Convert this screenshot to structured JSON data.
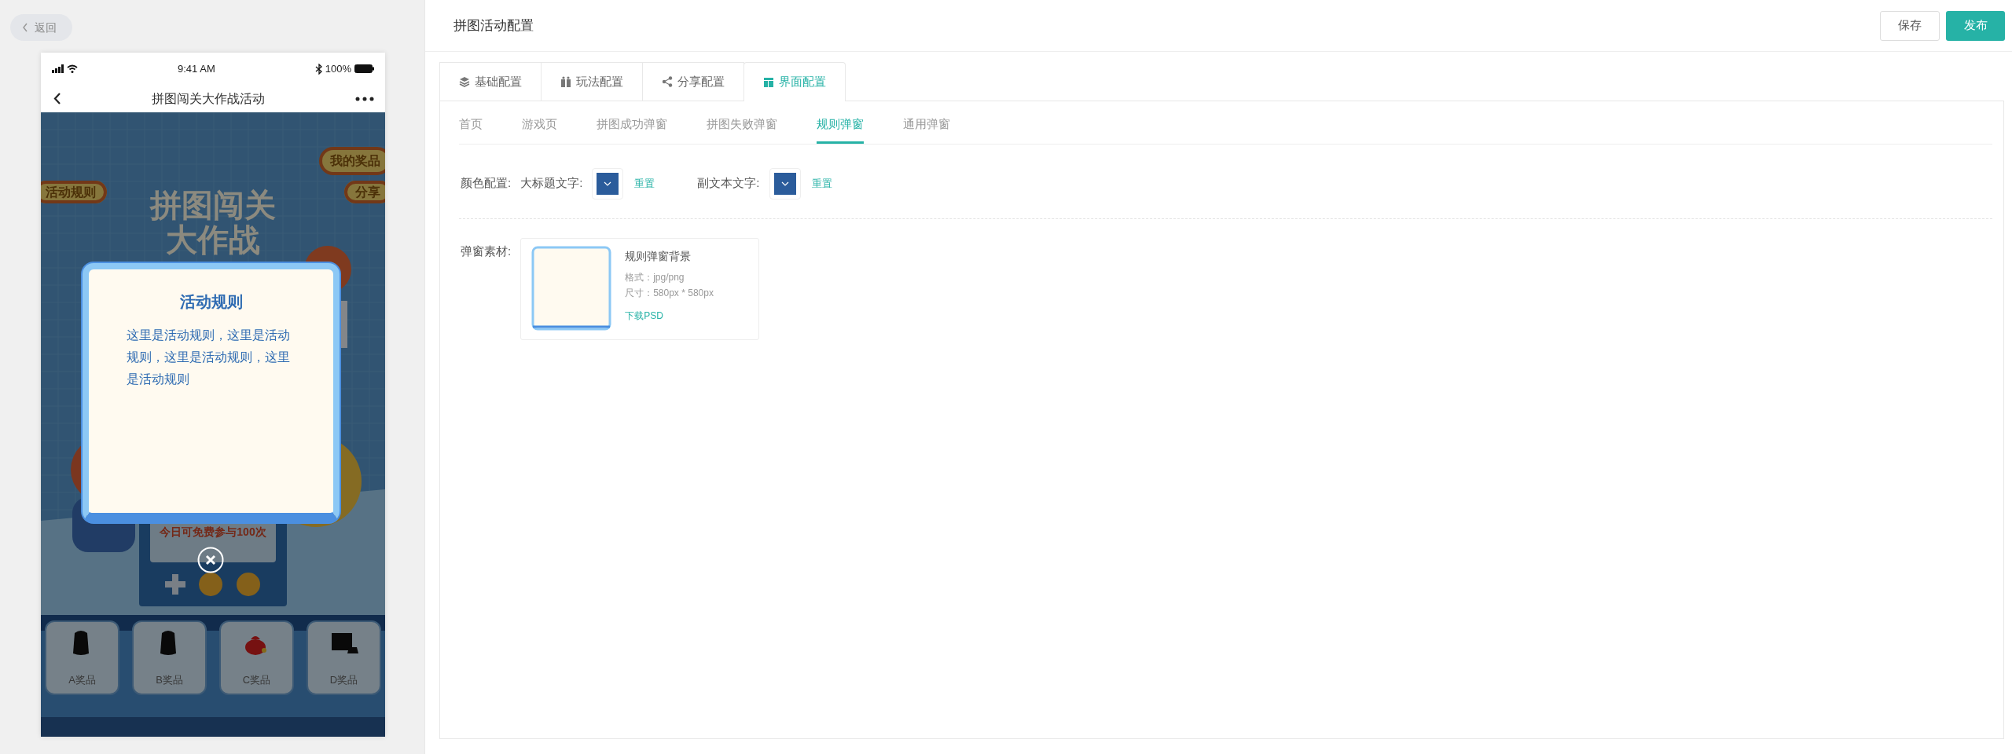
{
  "back_button": {
    "label": "返回"
  },
  "phone": {
    "status_bar": {
      "time": "9:41 AM",
      "battery": "100%"
    },
    "nav_title": "拼图闯关大作战活动",
    "game": {
      "top_buttons": [
        {
          "label": "我的奖品"
        },
        {
          "label": "活动规则"
        },
        {
          "label": "分享"
        }
      ],
      "banner_title": [
        "拼图闯关",
        "大作战"
      ],
      "free_plays": "今日可免费参与100次",
      "prizes": [
        {
          "label": "A奖品",
          "kind": "backpack"
        },
        {
          "label": "B奖品",
          "kind": "backpack"
        },
        {
          "label": "C奖品",
          "kind": "pouch"
        },
        {
          "label": "D奖品",
          "kind": "console"
        }
      ]
    },
    "rule_popup": {
      "title": "活动规则",
      "body": "这里是活动规则，这里是活动规则，这里是活动规则，这里是活动规则"
    }
  },
  "header": {
    "title": "拼图活动配置",
    "buttons": [
      {
        "label": "保存",
        "kind": "default"
      },
      {
        "label": "发布",
        "kind": "primary"
      }
    ]
  },
  "tabs": [
    {
      "label": "基础配置",
      "kind": "layers",
      "selected": false
    },
    {
      "label": "玩法配置",
      "kind": "gift",
      "selected": false
    },
    {
      "label": "分享配置",
      "kind": "share",
      "selected": false
    },
    {
      "label": "界面配置",
      "kind": "layout",
      "selected": true
    }
  ],
  "subtabs": [
    {
      "label": "首页",
      "selected": false
    },
    {
      "label": "游戏页",
      "selected": false
    },
    {
      "label": "拼图成功弹窗",
      "selected": false
    },
    {
      "label": "拼图失败弹窗",
      "selected": false
    },
    {
      "label": "规则弹窗",
      "selected": true
    },
    {
      "label": "通用弹窗",
      "selected": false
    }
  ],
  "color_config": {
    "label": "颜色配置:",
    "items": [
      {
        "label": "大标题文字:",
        "color": "#2b5c9b",
        "reset": "重置"
      },
      {
        "label": "副文本文字:",
        "color": "#2b5c9b",
        "reset": "重置"
      }
    ]
  },
  "material": {
    "label": "弹窗素材:",
    "items": [
      {
        "name": "规则弹窗背景",
        "format": "格式：jpg/png",
        "size": "尺寸：580px * 580px",
        "download": "下载PSD"
      }
    ]
  }
}
